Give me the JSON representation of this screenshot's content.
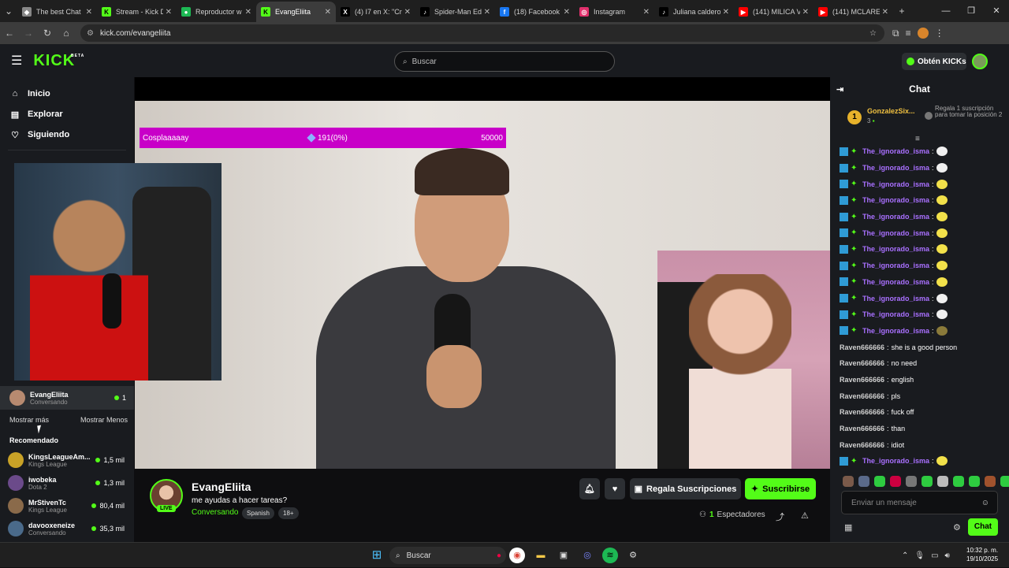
{
  "browser": {
    "tabs": [
      {
        "label": "The best Chat",
        "color": "#888888",
        "glyph": "◆"
      },
      {
        "label": "Stream - Kick D",
        "color": "#53fc18",
        "glyph": "K"
      },
      {
        "label": "Reproductor w",
        "color": "#1db954",
        "glyph": "●"
      },
      {
        "label": "EvangEliita",
        "color": "#53fc18",
        "glyph": "K"
      },
      {
        "label": "(4) I7 en X: \"Cr",
        "color": "#000000",
        "glyph": "X"
      },
      {
        "label": "Spider-Man Ed",
        "color": "#000000",
        "glyph": "♪"
      },
      {
        "label": "(18) Facebook",
        "color": "#1877f2",
        "glyph": "f"
      },
      {
        "label": "Instagram",
        "color": "#e1306c",
        "glyph": "◎"
      },
      {
        "label": "Juliana caldero",
        "color": "#000000",
        "glyph": "♪"
      },
      {
        "label": "(141) MILICA V",
        "color": "#ff0000",
        "glyph": "▶"
      },
      {
        "label": "(141) MCLARE",
        "color": "#ff0000",
        "glyph": "▶"
      }
    ],
    "url": "kick.com/evangeliita"
  },
  "kick": {
    "logo": "KICK",
    "beta": "BETA",
    "search_placeholder": "Buscar",
    "get_kicks": "Obtén KICKs",
    "nav": [
      {
        "label": "Inicio",
        "icon": "home-icon",
        "glyph": "⌂"
      },
      {
        "label": "Explorar",
        "icon": "explore-icon",
        "glyph": "▤"
      },
      {
        "label": "Siguiendo",
        "icon": "heart-icon",
        "glyph": "♡"
      }
    ],
    "following_channel": {
      "name": "EvangEliita",
      "status": "Conversando",
      "viewers": "1"
    },
    "show_more": "Mostrar más",
    "show_less": "Mostrar Menos",
    "recommended_title": "Recomendado",
    "recommended": [
      {
        "name": "KingsLeagueAm...",
        "category": "Kings League",
        "viewers": "1,5 mil",
        "color": "#c9a227"
      },
      {
        "name": "iwobeka",
        "category": "Dota 2",
        "viewers": "1,3 mil",
        "color": "#6b4a8a"
      },
      {
        "name": "MrStivenTc",
        "category": "Kings League",
        "viewers": "80,4 mil",
        "color": "#8a6a4a"
      },
      {
        "name": "davooxeneize",
        "category": "Conversando",
        "viewers": "35,3 mil",
        "color": "#4a6a8a"
      }
    ],
    "goal": {
      "label": "Cosplaaaaay",
      "progress": "191(0%)",
      "target": "50000"
    },
    "stream": {
      "streamer": "EvangEliita",
      "title": "me ayudas a hacer tareas?",
      "category": "Conversando",
      "tags": [
        "Spanish",
        "18+"
      ],
      "gift_label": "Regala Suscripciones",
      "subscribe_label": "Suscribirse",
      "viewers_count": "1",
      "viewers_label": "Espectadores",
      "live_badge": "LIVE"
    },
    "chat": {
      "title": "Chat",
      "pinned": {
        "rank": "1",
        "name": "GonzalezSix...",
        "count": "3",
        "gift_text": "Regala 1 suscripción para tomar la posición 2"
      },
      "messages": [
        {
          "user": "The_ignorado_isma",
          "text": "",
          "color": "#a970ff",
          "badges": true,
          "emote": "#f0f0f0"
        },
        {
          "user": "The_ignorado_isma",
          "text": "",
          "color": "#a970ff",
          "badges": true,
          "emote": "#f0f0f0"
        },
        {
          "user": "The_ignorado_isma",
          "text": "",
          "color": "#a970ff",
          "badges": true,
          "emote": "#f2e14a"
        },
        {
          "user": "The_ignorado_isma",
          "text": "",
          "color": "#a970ff",
          "badges": true,
          "emote": "#f2e14a"
        },
        {
          "user": "The_ignorado_isma",
          "text": "",
          "color": "#a970ff",
          "badges": true,
          "emote": "#f2e14a"
        },
        {
          "user": "The_ignorado_isma",
          "text": "",
          "color": "#a970ff",
          "badges": true,
          "emote": "#f2e14a"
        },
        {
          "user": "The_ignorado_isma",
          "text": "",
          "color": "#a970ff",
          "badges": true,
          "emote": "#f2e14a"
        },
        {
          "user": "The_ignorado_isma",
          "text": "",
          "color": "#a970ff",
          "badges": true,
          "emote": "#f2e14a"
        },
        {
          "user": "The_ignorado_isma",
          "text": "",
          "color": "#a970ff",
          "badges": true,
          "emote": "#f2e14a"
        },
        {
          "user": "The_ignorado_isma",
          "text": "",
          "color": "#a970ff",
          "badges": true,
          "emote": "#f0f0f0"
        },
        {
          "user": "The_ignorado_isma",
          "text": "",
          "color": "#a970ff",
          "badges": true,
          "emote": "#f0f0f0"
        },
        {
          "user": "The_ignorado_isma",
          "text": "",
          "color": "#a970ff",
          "badges": true,
          "emote": "#8a7a3a"
        },
        {
          "user": "Raven666666",
          "text": "she is a good person",
          "color": "#d0d0d0",
          "badges": false
        },
        {
          "user": "Raven666666",
          "text": "no need",
          "color": "#d0d0d0",
          "badges": false
        },
        {
          "user": "Raven666666",
          "text": "english",
          "color": "#d0d0d0",
          "badges": false
        },
        {
          "user": "Raven666666",
          "text": "pls",
          "color": "#d0d0d0",
          "badges": false
        },
        {
          "user": "Raven666666",
          "text": "fuck off",
          "color": "#d0d0d0",
          "badges": false
        },
        {
          "user": "Raven666666",
          "text": "than",
          "color": "#d0d0d0",
          "badges": false
        },
        {
          "user": "Raven666666",
          "text": "idiot",
          "color": "#d0d0d0",
          "badges": false
        },
        {
          "user": "The_ignorado_isma",
          "text": "",
          "color": "#a970ff",
          "badges": true,
          "emote": "#f2e14a"
        }
      ],
      "input_placeholder": "Enviar un mensaje",
      "send_label": "Chat"
    }
  },
  "taskbar": {
    "search_placeholder": "Buscar",
    "time": "10:32 p. m.",
    "date": "19/10/2025"
  },
  "colors": {
    "accent": "#53fc18",
    "goal": "#c800c8"
  }
}
